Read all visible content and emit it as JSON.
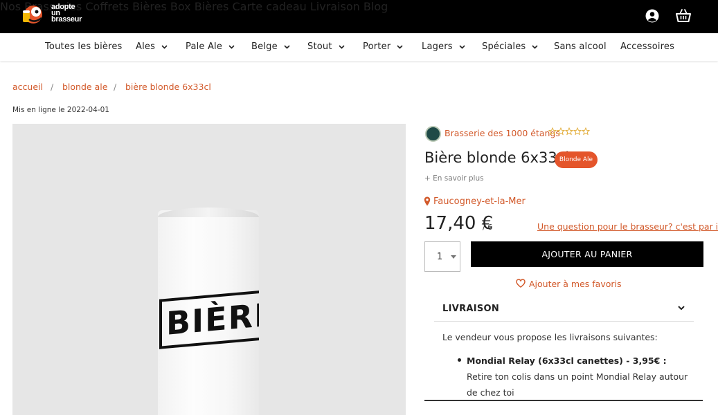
{
  "brand": {
    "logo_text_1": "adopte",
    "logo_text_2": "un",
    "logo_text_3": "brasseur"
  },
  "topnav": {
    "items": [
      "Nos Brasseries",
      "Coffrets Bières",
      "Box Bières",
      "Carte cadeau",
      "Livraison",
      "Blog"
    ],
    "icons": [
      "user-icon",
      "basket-icon"
    ]
  },
  "catnav": {
    "items": [
      {
        "label": "Toutes les bières",
        "dropdown": false
      },
      {
        "label": "Ales",
        "dropdown": true
      },
      {
        "label": "Pale Ale",
        "dropdown": true
      },
      {
        "label": "Belge",
        "dropdown": true
      },
      {
        "label": "Stout",
        "dropdown": true
      },
      {
        "label": "Porter",
        "dropdown": true
      },
      {
        "label": "Lagers",
        "dropdown": true
      },
      {
        "label": "Spéciales",
        "dropdown": true
      },
      {
        "label": "Sans alcool",
        "dropdown": false
      },
      {
        "label": "Accessoires",
        "dropdown": false
      }
    ]
  },
  "breadcrumb": {
    "items": [
      "accueil",
      "blonde ale",
      "bière blonde 6x33cl"
    ],
    "separator": "/"
  },
  "published": "Mis en ligne le 2022-04-01",
  "product": {
    "image_label": "BIÈRE",
    "brewer": "Brasserie des 1000 étangs",
    "rating": 0,
    "rating_max": 5,
    "title": "Bière blonde 6x33cl",
    "badge": "Blonde Ale",
    "more_info": "+ En savoir plus",
    "location": "Faucogney-et-la-Mer",
    "price": "17,40 €",
    "unit": "/ 6",
    "question_link": "Une question pour le brasseur? c'est par ici",
    "quantity": "1",
    "add_to_cart": "AJOUTER AU PANIER",
    "favorites": "Ajouter à mes favoris"
  },
  "shipping": {
    "heading": "LIVRAISON",
    "intro": "Le vendeur vous propose les livraisons suivantes:",
    "option_title": "Mondial Relay (6x33cl canettes) - 3,95€ :",
    "option_desc": " Retire ton colis dans un point Mondial Relay autour de chez toi"
  },
  "colors": {
    "accent": "#d2592a",
    "badge": "#e4552b",
    "topbar": "#000000"
  }
}
